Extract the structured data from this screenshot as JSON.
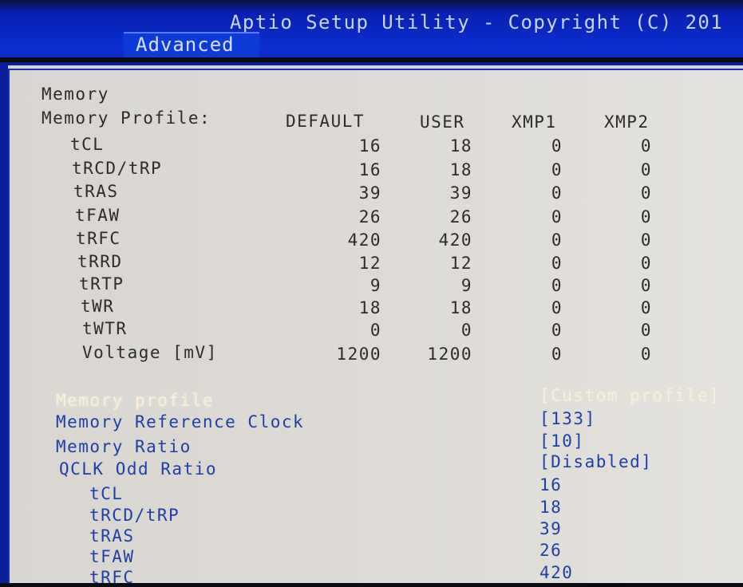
{
  "header": {
    "title": "Aptio Setup Utility - Copyright (C) 201",
    "tab": "Advanced"
  },
  "memory": {
    "section_label": "Memory",
    "profile_label": "Memory Profile:",
    "columns": [
      "DEFAULT",
      "USER",
      "XMP1",
      "XMP2"
    ],
    "rows": [
      {
        "label": "tCL",
        "values": [
          "16",
          "18",
          "0",
          "0"
        ]
      },
      {
        "label": "tRCD/tRP",
        "values": [
          "16",
          "18",
          "0",
          "0"
        ]
      },
      {
        "label": "tRAS",
        "values": [
          "39",
          "39",
          "0",
          "0"
        ]
      },
      {
        "label": "tFAW",
        "values": [
          "26",
          "26",
          "0",
          "0"
        ]
      },
      {
        "label": "tRFC",
        "values": [
          "420",
          "420",
          "0",
          "0"
        ]
      },
      {
        "label": "tRRD",
        "values": [
          "12",
          "12",
          "0",
          "0"
        ]
      },
      {
        "label": "tRTP",
        "values": [
          "9",
          "9",
          "0",
          "0"
        ]
      },
      {
        "label": "tWR",
        "values": [
          "18",
          "18",
          "0",
          "0"
        ]
      },
      {
        "label": "tWTR",
        "values": [
          "0",
          "0",
          "0",
          "0"
        ]
      },
      {
        "label": "Voltage [mV]",
        "values": [
          "1200",
          "1200",
          "0",
          "0"
        ]
      }
    ]
  },
  "settings": [
    {
      "label": "Memory profile",
      "value": "[Custom profile]",
      "selected": true
    },
    {
      "label": "Memory Reference Clock",
      "value": "[133]",
      "selected": false
    },
    {
      "label": "Memory Ratio",
      "value": "[10]",
      "selected": false
    },
    {
      "label": "QCLK Odd Ratio",
      "value": "[Disabled]",
      "selected": false
    }
  ],
  "timings": [
    {
      "label": "tCL",
      "value": "16"
    },
    {
      "label": "tRCD/tRP",
      "value": "18"
    },
    {
      "label": "tRAS",
      "value": "39"
    },
    {
      "label": "tFAW",
      "value": "26"
    },
    {
      "label": "tRFC",
      "value": "420"
    }
  ],
  "colors": {
    "header_blue": "#0b2fd0",
    "panel_gray": "#d9d6d2",
    "item_blue": "#1f3fa8",
    "highlight": "#f3efe4"
  }
}
